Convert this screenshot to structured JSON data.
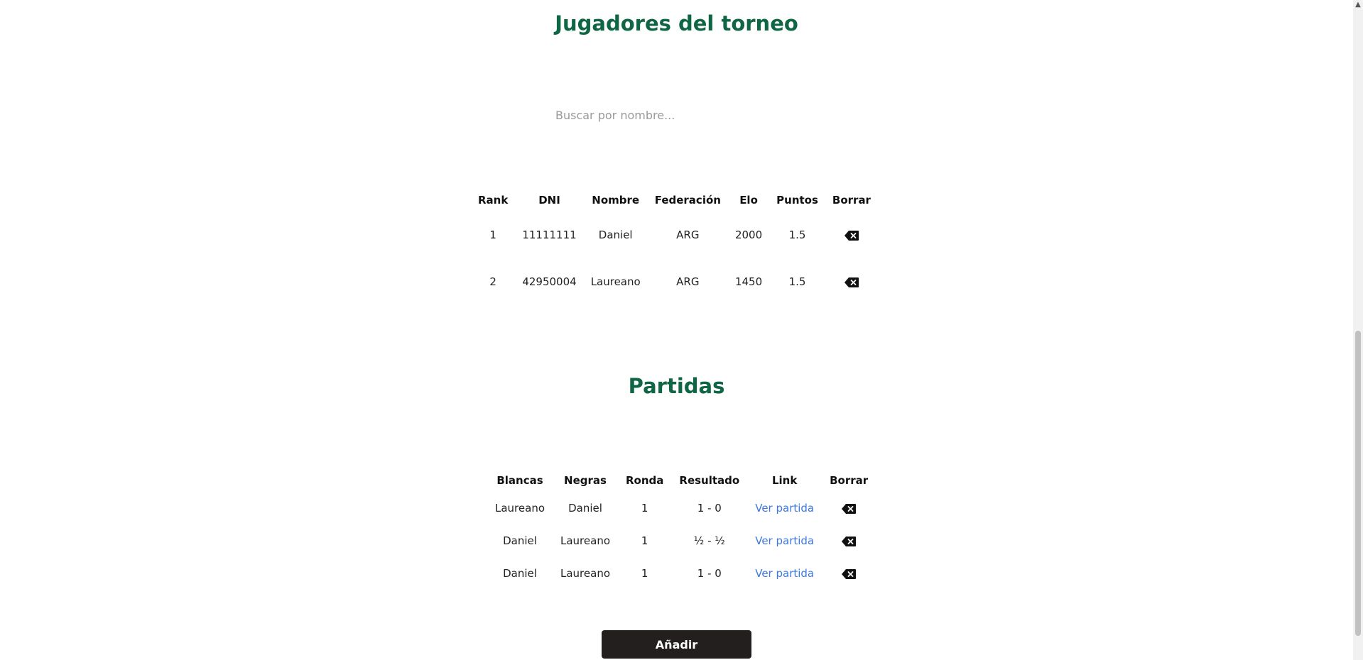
{
  "players_section": {
    "title": "Jugadores del torneo",
    "search_placeholder": "Buscar por nombre...",
    "columns": [
      "Rank",
      "DNI",
      "Nombre",
      "Federación",
      "Elo",
      "Puntos",
      "Borrar"
    ],
    "rows": [
      {
        "rank": "1",
        "dni": "11111111",
        "name": "Daniel",
        "federation": "ARG",
        "elo": "2000",
        "points": "1.5"
      },
      {
        "rank": "2",
        "dni": "42950004",
        "name": "Laureano",
        "federation": "ARG",
        "elo": "1450",
        "points": "1.5"
      }
    ]
  },
  "games_section": {
    "title": "Partidas",
    "columns": [
      "Blancas",
      "Negras",
      "Ronda",
      "Resultado",
      "Link",
      "Borrar"
    ],
    "rows": [
      {
        "white": "Laureano",
        "black": "Daniel",
        "round": "1",
        "result": "1 - 0",
        "link": "Ver partida"
      },
      {
        "white": "Daniel",
        "black": "Laureano",
        "round": "1",
        "result": "½ - ½",
        "link": "Ver partida"
      },
      {
        "white": "Daniel",
        "black": "Laureano",
        "round": "1",
        "result": "1 - 0",
        "link": "Ver partida"
      }
    ],
    "add_label": "Añadir"
  },
  "icons": {
    "delete": "backspace-delete-icon",
    "scroll_up": "chevron-up-icon"
  },
  "colors": {
    "heading": "#0f6644",
    "link": "#3b78e0",
    "button_bg": "#231f1f"
  }
}
